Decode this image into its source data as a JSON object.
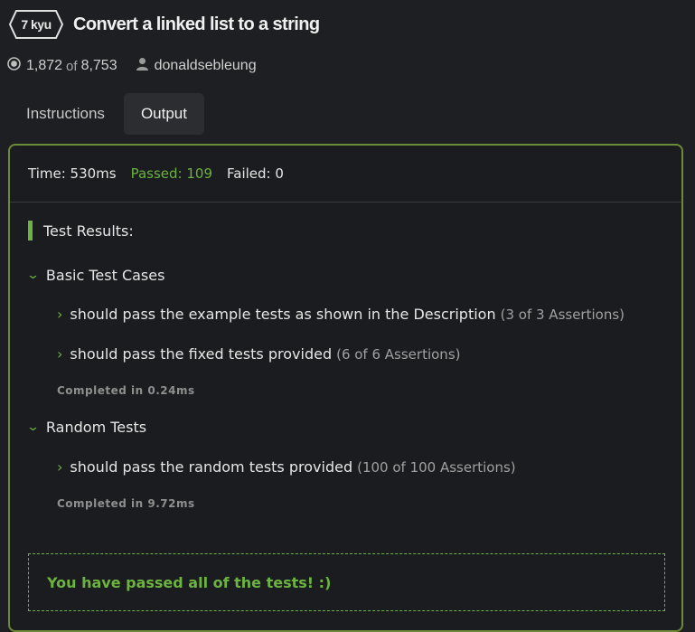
{
  "kata": {
    "rank": "7 kyu",
    "title": "Convert a linked list to a string",
    "rank_position": "1,872",
    "of_label": "of",
    "total": "8,753",
    "author": "donaldsebleung"
  },
  "tabs": [
    {
      "label": "Instructions",
      "active": false
    },
    {
      "label": "Output",
      "active": true
    }
  ],
  "stats": {
    "time": "Time: 530ms",
    "passed": "Passed: 109",
    "failed": "Failed: 0"
  },
  "results": {
    "heading": "Test Results:",
    "groups": [
      {
        "title": "Basic Test Cases",
        "tests": [
          {
            "name": "should pass the example tests as shown in the Description",
            "assertions": "(3 of 3 Assertions)"
          },
          {
            "name": "should pass the fixed tests provided",
            "assertions": "(6 of 6 Assertions)"
          }
        ],
        "completed": "Completed in 0.24ms"
      },
      {
        "title": "Random Tests",
        "tests": [
          {
            "name": "should pass the random tests provided",
            "assertions": "(100 of 100 Assertions)"
          }
        ],
        "completed": "Completed in 9.72ms"
      }
    ],
    "success_message": "You have passed all of the tests! :)"
  },
  "colors": {
    "accent_green": "#6cb33f",
    "panel_border": "#6d8a3a",
    "background": "#1e1f22"
  }
}
